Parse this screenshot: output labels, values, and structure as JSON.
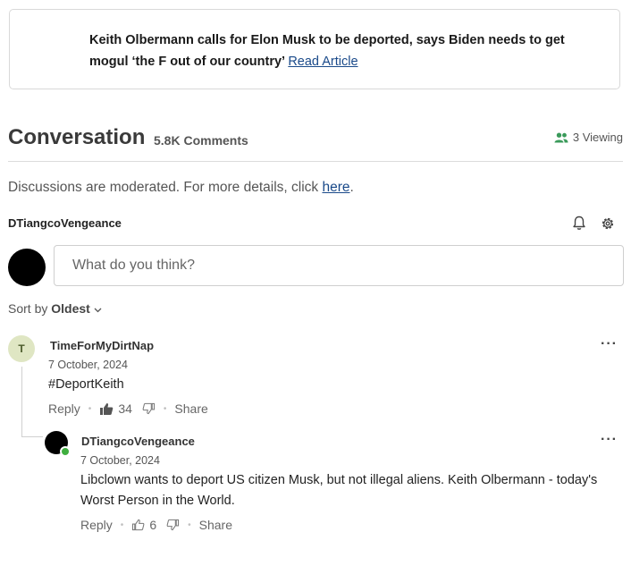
{
  "article": {
    "headline": "Keith Olbermann calls for Elon Musk to be deported, says Biden needs to get mogul ‘the F out of our country’",
    "link_label": "Read Article"
  },
  "conversation": {
    "title": "Conversation",
    "count": "5.8K Comments",
    "viewing": "3 Viewing",
    "moderation_text": "Discussions are moderated. For more details, click",
    "moderation_link": "here",
    "moderation_suffix": "."
  },
  "current_user": {
    "name": "DTiangcoVengeance"
  },
  "composer": {
    "placeholder": "What do you think?"
  },
  "sort": {
    "label": "Sort by",
    "value": "Oldest"
  },
  "comments": [
    {
      "avatar_initial": "T",
      "user": "TimeForMyDirtNap",
      "date": "7 October, 2024",
      "text": "#DeportKeith",
      "reply_label": "Reply",
      "likes": "34",
      "share_label": "Share"
    },
    {
      "user": "DTiangcoVengeance",
      "date": "7 October, 2024",
      "text": "Libclown wants to deport US citizen Musk, but not illegal aliens. Keith Olbermann - today's Worst Person in the World.",
      "reply_label": "Reply",
      "likes": "6",
      "share_label": "Share"
    }
  ],
  "colors": {
    "link": "#1a4a8a",
    "online": "#3fae3f",
    "viewing_icon": "#3a9a5a"
  },
  "icons": [
    "users-icon",
    "bell-icon",
    "gear-icon",
    "chevron-down-icon",
    "thumbs-up-icon",
    "thumbs-down-icon",
    "more-icon"
  ]
}
